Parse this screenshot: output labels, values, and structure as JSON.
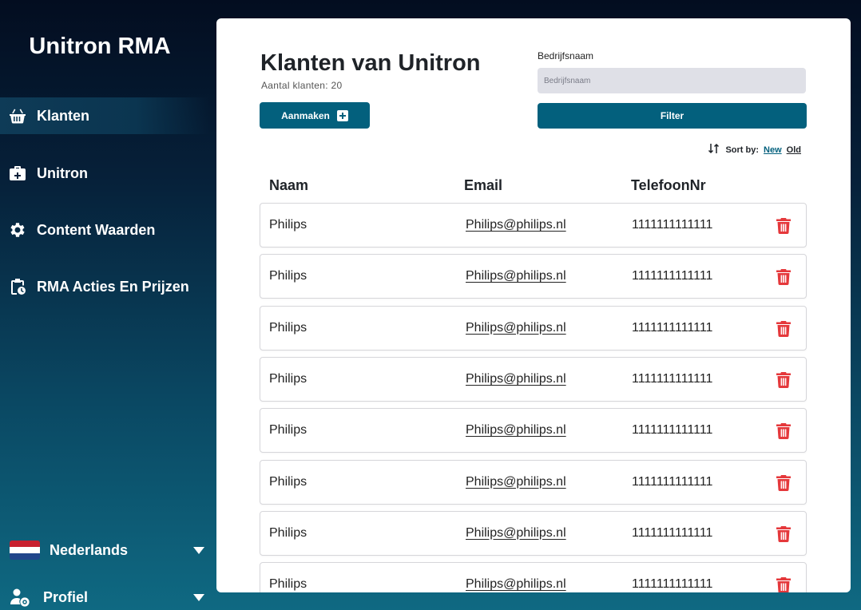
{
  "app": {
    "title": "Unitron RMA"
  },
  "sidebar": {
    "items": [
      {
        "label": "Klanten",
        "icon": "basket-icon",
        "active": true
      },
      {
        "label": "Unitron",
        "icon": "medical-bag-icon",
        "active": false
      },
      {
        "label": "Content Waarden",
        "icon": "gear-icon",
        "active": false
      },
      {
        "label": "RMA Acties En Prijzen",
        "icon": "clipboard-clock-icon",
        "active": false
      }
    ],
    "language": {
      "label": "Nederlands",
      "icon": "nl-flag-icon"
    },
    "profile": {
      "label": "Profiel",
      "icon": "user-gear-icon"
    }
  },
  "main": {
    "title": "Klanten van Unitron",
    "subtitle": "Aantal klanten: 20",
    "create_label": "Aanmaken",
    "filter": {
      "label": "Bedrijfsnaam",
      "placeholder": "Bedrijfsnaam",
      "value": "",
      "button_label": "Filter"
    },
    "sort": {
      "label": "Sort by:",
      "new": "New",
      "old": "Old",
      "selected": "New"
    },
    "table": {
      "headers": [
        "Naam",
        "Email",
        "TelefoonNr"
      ],
      "rows": [
        {
          "name": "Philips",
          "email": "Philips@philips.nl",
          "phone": "1111111111111"
        },
        {
          "name": "Philips",
          "email": "Philips@philips.nl",
          "phone": "1111111111111"
        },
        {
          "name": "Philips",
          "email": "Philips@philips.nl",
          "phone": "1111111111111"
        },
        {
          "name": "Philips",
          "email": "Philips@philips.nl",
          "phone": "1111111111111"
        },
        {
          "name": "Philips",
          "email": "Philips@philips.nl",
          "phone": "1111111111111"
        },
        {
          "name": "Philips",
          "email": "Philips@philips.nl",
          "phone": "1111111111111"
        },
        {
          "name": "Philips",
          "email": "Philips@philips.nl",
          "phone": "1111111111111"
        },
        {
          "name": "Philips",
          "email": "Philips@philips.nl",
          "phone": "1111111111111"
        }
      ]
    }
  },
  "colors": {
    "accent": "#03607d",
    "danger": "#e5383b",
    "text": "#1f2328"
  }
}
